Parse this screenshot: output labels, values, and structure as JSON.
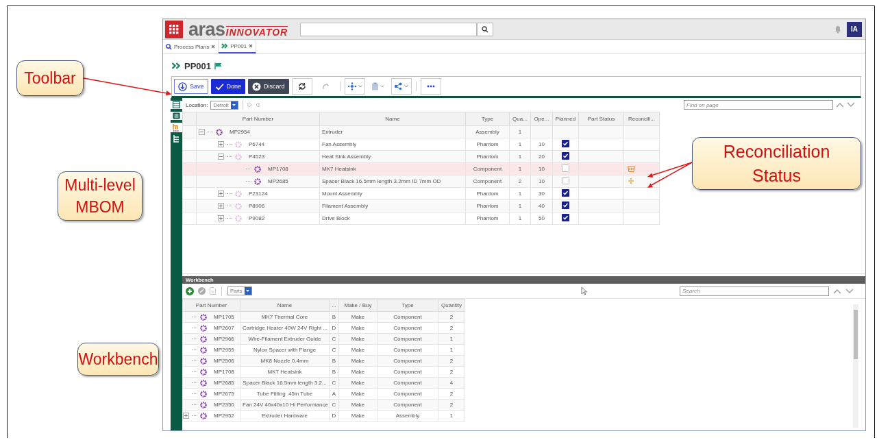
{
  "header": {
    "logo": "aras",
    "logo_sub": "INNOVATOR",
    "user_initials": "IA"
  },
  "tabs": [
    {
      "label": "Process Plans",
      "kind": "search",
      "selected": false
    },
    {
      "label": "PP001",
      "kind": "item",
      "selected": true
    }
  ],
  "item_title": "PP001",
  "toolbar": {
    "buttons": [
      {
        "label": "Save",
        "kind": "outline"
      },
      {
        "label": "Done",
        "kind": "primary"
      },
      {
        "label": "Discard",
        "kind": "dark"
      }
    ]
  },
  "location": {
    "label": "Location:",
    "value": "Detroit"
  },
  "find": {
    "placeholder": "Find on page"
  },
  "mbom": {
    "columns": [
      "Part Number",
      "Name",
      "Type",
      "Qua...",
      "Ope...",
      "Planned",
      "Part Status",
      "Reconcili..."
    ],
    "rows": [
      {
        "part_number": "MP2954",
        "name": "Extruder",
        "type": "Assembly",
        "quantity": "1",
        "kind": "part",
        "selected": false,
        "expanded": true,
        "children": [
          {
            "part_number": "P6744",
            "name": "Fan Assembly",
            "type": "Phantom",
            "quantity": "1",
            "operation": "10",
            "planned": true,
            "kind": "phantom",
            "selected": false,
            "expanded": false
          },
          {
            "part_number": "P4523",
            "name": "Heat Sink Assembly",
            "type": "Phantom",
            "quantity": "1",
            "operation": "20",
            "planned": true,
            "kind": "phantom",
            "selected": false,
            "expanded": true,
            "children": [
              {
                "part_number": "MP1708",
                "name": "MK7 Heatsink",
                "type": "Component",
                "quantity": "1",
                "operation": "10",
                "planned": false,
                "kind": "part",
                "selected": true,
                "reconciliation": {
                  "kind": "basket"
                }
              },
              {
                "part_number": "MP2685",
                "name": "Spacer Black 16.5mm length 3.2mm ID 7mm OD",
                "type": "Component",
                "quantity": "2",
                "operation": "10",
                "planned": false,
                "kind": "part",
                "selected": false,
                "reconciliation": {
                  "kind": "divide"
                }
              }
            ]
          },
          {
            "part_number": "P23124",
            "name": "Mount Assembly",
            "type": "Phantom",
            "quantity": "1",
            "operation": "30",
            "planned": true,
            "kind": "phantom",
            "selected": false,
            "expanded": false
          },
          {
            "part_number": "P8906",
            "name": "Filament Assembly",
            "type": "Phantom",
            "quantity": "1",
            "operation": "40",
            "planned": true,
            "kind": "phantom",
            "selected": false,
            "expanded": false
          },
          {
            "part_number": "P9082",
            "name": "Drive Block",
            "type": "Phantom",
            "quantity": "1",
            "operation": "50",
            "planned": true,
            "kind": "phantom",
            "selected": false,
            "expanded": false
          }
        ]
      }
    ]
  },
  "workbench": {
    "title": "Workbench",
    "filter": "Parts",
    "search": {
      "placeholder": "Search"
    },
    "columns": [
      "Part Number",
      "Name",
      "...",
      "Make / Buy",
      "Type",
      "Quantity"
    ],
    "rows": [
      {
        "part_number": "MP1705",
        "name": "MK7 Thermal Core",
        "column_3": "B",
        "make_buy": "Make",
        "type": "Component",
        "quantity": "2"
      },
      {
        "part_number": "MP2607",
        "name": "Cartridge Heater 40W 24V Right ...",
        "column_3": "D",
        "make_buy": "Make",
        "type": "Component",
        "quantity": "2"
      },
      {
        "part_number": "MP2966",
        "name": "Wire-Filament Extruder Guide",
        "column_3": "C",
        "make_buy": "Make",
        "type": "Component",
        "quantity": "1"
      },
      {
        "part_number": "MP2959",
        "name": "Nylon Spacer with Flange",
        "column_3": "C",
        "make_buy": "Make",
        "type": "Component",
        "quantity": "1"
      },
      {
        "part_number": "MP2506",
        "name": "MK8 Nozzle 0.4mm",
        "column_3": "B",
        "make_buy": "Make",
        "type": "Component",
        "quantity": "2"
      },
      {
        "part_number": "MP1708",
        "name": "MK7 Heatsink",
        "column_3": "B",
        "make_buy": "Make",
        "type": "Component",
        "quantity": "2"
      },
      {
        "part_number": "MP2685",
        "name": "Spacer Black 16.5mm length 3.2...",
        "column_3": "C",
        "make_buy": "Make",
        "type": "Component",
        "quantity": "4"
      },
      {
        "part_number": "MP2675",
        "name": "Tube Fitting .45in Tube",
        "column_3": "A",
        "make_buy": "Make",
        "type": "Component",
        "quantity": "2"
      },
      {
        "part_number": "MP2350",
        "name": "Fan 24V 40x40x10 Hi Performance",
        "column_3": "C",
        "make_buy": "Make",
        "type": "Component",
        "quantity": "2"
      },
      {
        "part_number": "MP2952",
        "name": "Extruder Hardware",
        "column_3": "D",
        "make_buy": "Make",
        "type": "Assembly",
        "quantity": "1",
        "expanded": false
      }
    ]
  },
  "annotations": [
    {
      "text": "Toolbar"
    },
    {
      "text": "Multi-level MBOM"
    },
    {
      "text": "Reconciliation Status"
    },
    {
      "text": "Workbench"
    }
  ]
}
